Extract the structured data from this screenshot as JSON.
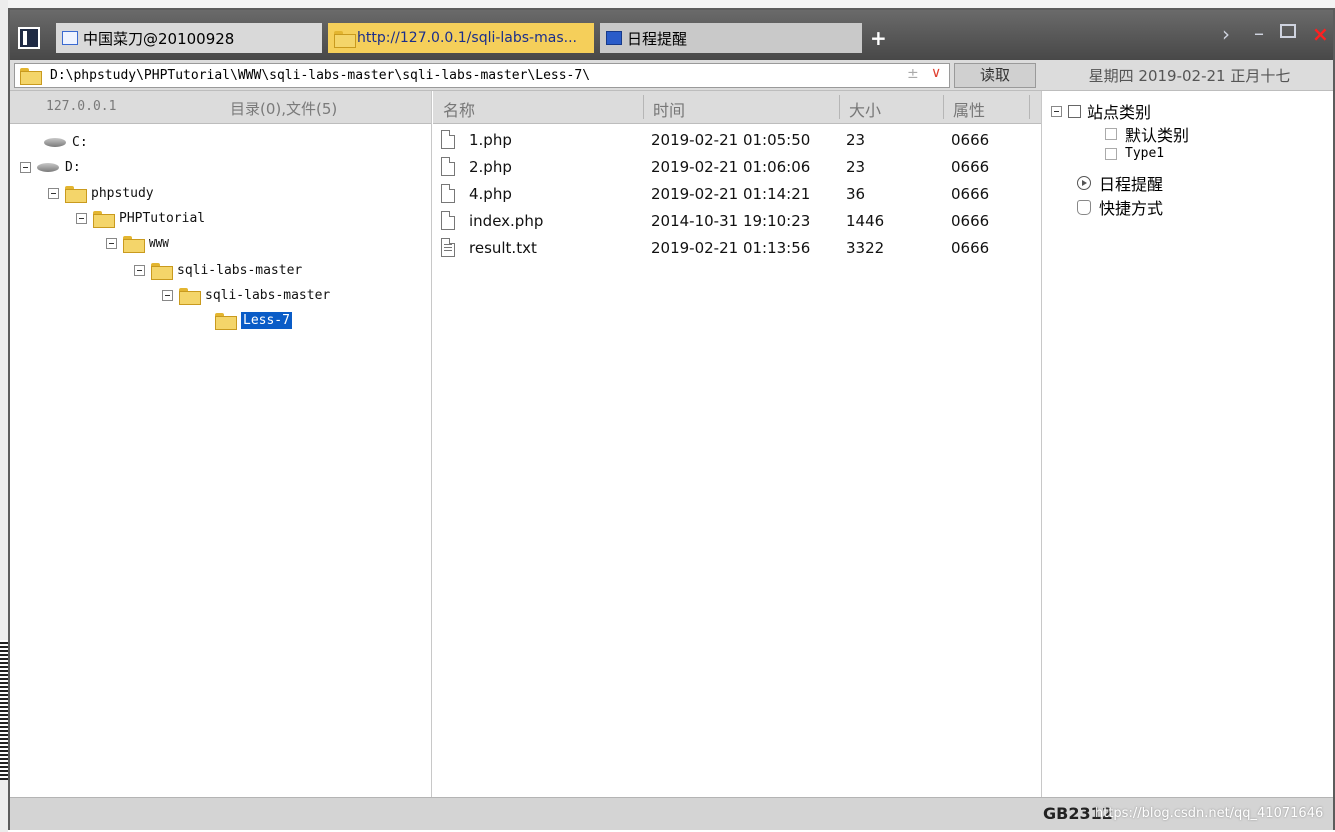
{
  "tabs": [
    {
      "label": "中国菜刀@20100928"
    },
    {
      "label": "http://127.0.0.1/sqli-labs-mas..."
    },
    {
      "label": "日程提醒"
    }
  ],
  "window_controls": {
    "new_tab": "+",
    "next": "›",
    "minimize": "–",
    "close": "×"
  },
  "address": {
    "path": "D:\\phpstudy\\PHPTutorial\\WWW\\sqli-labs-master\\sqli-labs-master\\Less-7\\",
    "plus": "±",
    "caret": "∨",
    "read_button": "读取",
    "date": "星期四 2019-02-21 正月十七"
  },
  "tree": {
    "host": "127.0.0.1",
    "summary": "目录(0),文件(5)",
    "nodes": [
      "C:",
      "D:",
      "phpstudy",
      "PHPTutorial",
      "WWW",
      "sqli-labs-master",
      "sqli-labs-master",
      "Less-7"
    ]
  },
  "files": {
    "columns": [
      "名称",
      "时间",
      "大小",
      "属性"
    ],
    "rows": [
      {
        "name": "1.php",
        "time": "2019-02-21 01:05:50",
        "size": "23",
        "attr": "0666",
        "icon": "file-icon"
      },
      {
        "name": "2.php",
        "time": "2019-02-21 01:06:06",
        "size": "23",
        "attr": "0666",
        "icon": "file-icon"
      },
      {
        "name": "4.php",
        "time": "2019-02-21 01:14:21",
        "size": "36",
        "attr": "0666",
        "icon": "file-icon"
      },
      {
        "name": "index.php",
        "time": "2014-10-31 19:10:23",
        "size": "1446",
        "attr": "0666",
        "icon": "file-icon"
      },
      {
        "name": "result.txt",
        "time": "2019-02-21 01:13:56",
        "size": "3322",
        "attr": "0666",
        "icon": "text-file-icon"
      }
    ]
  },
  "right_panel": {
    "site_category": "站点类别",
    "default_category": "默认类别",
    "type1": "Type1",
    "schedule": "日程提醒",
    "shortcuts": "快捷方式"
  },
  "status": {
    "encoding": "GB2312",
    "watermark": "https://blog.csdn.net/qq_41071646"
  },
  "colors": {
    "tab_active": "#f5cf5a",
    "selection": "#0a5cc7",
    "close": "#ff2020"
  }
}
